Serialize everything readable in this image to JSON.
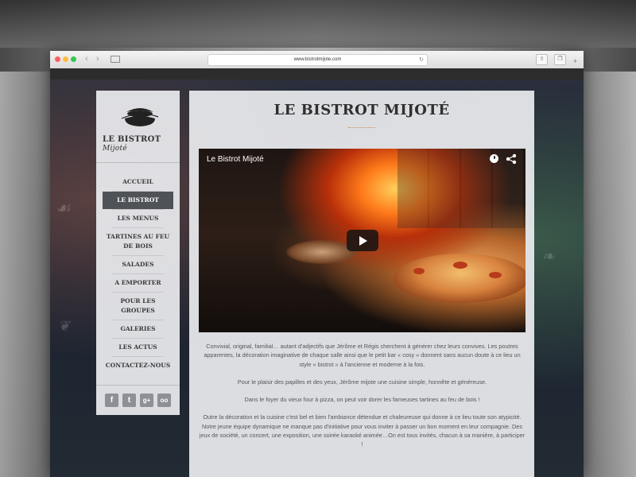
{
  "browser": {
    "url": "www.bistrotmijote.com"
  },
  "site": {
    "logo": {
      "main": "LE BISTROT",
      "script": "Mijoté"
    },
    "menu": [
      {
        "label": "ACCUEIL",
        "active": false
      },
      {
        "label": "LE BISTROT",
        "active": true
      },
      {
        "label": "LES MENUS",
        "active": false
      },
      {
        "label": "TARTINES AU FEU DE BOIS",
        "active": false
      },
      {
        "label": "SALADES",
        "active": false
      },
      {
        "label": "A EMPORTER",
        "active": false
      },
      {
        "label": "POUR LES GROUPES",
        "active": false
      },
      {
        "label": "GALERIES",
        "active": false
      },
      {
        "label": "LES ACTUS",
        "active": false
      },
      {
        "label": "CONTACTEZ-NOUS",
        "active": false
      }
    ],
    "social": [
      {
        "icon": "facebook-icon",
        "glyph": "f"
      },
      {
        "icon": "twitter-icon",
        "glyph": "t"
      },
      {
        "icon": "google-plus-icon",
        "glyph": "g+"
      },
      {
        "icon": "tripadvisor-icon",
        "glyph": "oo"
      }
    ],
    "page_title": "LE BISTROT MIJOTÉ",
    "video": {
      "title": "Le Bistrot Mijoté"
    },
    "paragraphs": [
      "Convivial, original, familial… autant d'adjectifs que Jérôme et Régis cherchent à générer chez leurs convives. Les poutres apparentes, la décoration imaginative de chaque salle ainsi que le petit bar « cosy » donnent sans aucun doute à ce lieu un style « bistrot » à l'ancienne et moderne à la fois.",
      "Pour le plaisir des papilles et des yeux, Jérôme mijote une cuisine simple, honnête et généreuse.",
      "Dans le foyer du vieux four à pizza, on peut voir dorer les fameuses tartines au feu de bois !",
      "Outre la décoration et la cuisine c'est bel et bien l'ambiance détendue et chaleureuse qui donne à ce lieu toute son atypicité. Notre jeune équipe dynamique ne manque pas d'initiative pour vous inviter à passer un bon moment en leur compagnie. Des jeux de société, un concert, une exposition, une soirée karaoké animée…On est tous invités, chacun à sa manière, à participer !"
    ],
    "colors": {
      "active_menu": "#4f5257",
      "panel": "#eceef0",
      "title": "#2f2f2f"
    }
  }
}
